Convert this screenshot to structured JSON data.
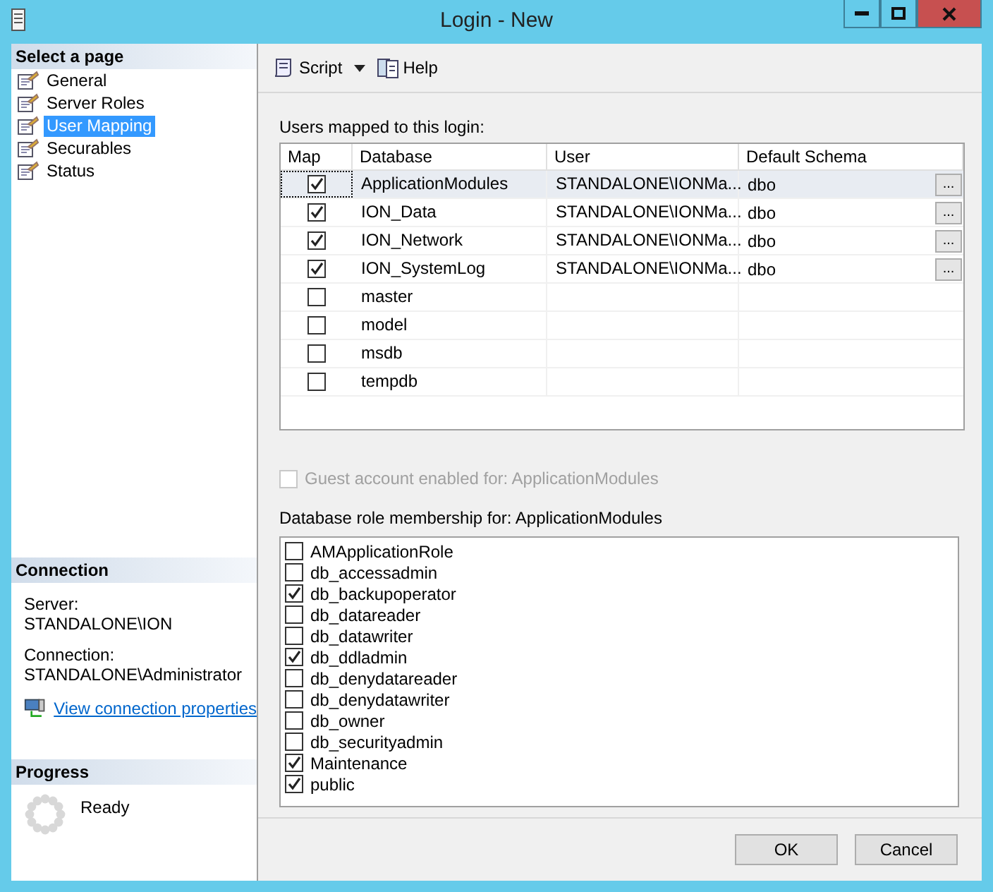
{
  "window": {
    "title": "Login - New"
  },
  "sidebar": {
    "header": "Select a page",
    "items": [
      {
        "label": "General",
        "selected": false
      },
      {
        "label": "Server Roles",
        "selected": false
      },
      {
        "label": "User Mapping",
        "selected": true
      },
      {
        "label": "Securables",
        "selected": false
      },
      {
        "label": "Status",
        "selected": false
      }
    ]
  },
  "connection": {
    "header": "Connection",
    "server_label": "Server:",
    "server": "STANDALONE\\ION",
    "connection_label": "Connection:",
    "connection": "STANDALONE\\Administrator",
    "link": "View connection properties"
  },
  "progress": {
    "header": "Progress",
    "status": "Ready"
  },
  "toolbar": {
    "script": "Script",
    "help": "Help"
  },
  "mapping": {
    "label": "Users mapped to this login:",
    "columns": [
      "Map",
      "Database",
      "User",
      "Default Schema"
    ],
    "rows": [
      {
        "map": true,
        "database": "ApplicationModules",
        "user": "STANDALONE\\IONMa...",
        "schema": "dbo",
        "browse": "...",
        "selected": true
      },
      {
        "map": true,
        "database": "ION_Data",
        "user": "STANDALONE\\IONMa...",
        "schema": "dbo",
        "browse": "...",
        "selected": false
      },
      {
        "map": true,
        "database": "ION_Network",
        "user": "STANDALONE\\IONMa...",
        "schema": "dbo",
        "browse": "...",
        "selected": false
      },
      {
        "map": true,
        "database": "ION_SystemLog",
        "user": "STANDALONE\\IONMa...",
        "schema": "dbo",
        "browse": "...",
        "selected": false
      },
      {
        "map": false,
        "database": "master",
        "selected": false
      },
      {
        "map": false,
        "database": "model",
        "selected": false
      },
      {
        "map": false,
        "database": "msdb",
        "selected": false
      },
      {
        "map": false,
        "database": "tempdb",
        "selected": false
      }
    ]
  },
  "guest": {
    "label": "Guest account enabled for: ApplicationModules",
    "checked": false,
    "disabled": true
  },
  "roles": {
    "label": "Database role membership for: ApplicationModules",
    "items": [
      {
        "label": "AMApplicationRole",
        "checked": false
      },
      {
        "label": "db_accessadmin",
        "checked": false
      },
      {
        "label": "db_backupoperator",
        "checked": true
      },
      {
        "label": "db_datareader",
        "checked": false
      },
      {
        "label": "db_datawriter",
        "checked": false
      },
      {
        "label": "db_ddladmin",
        "checked": true
      },
      {
        "label": "db_denydatareader",
        "checked": false
      },
      {
        "label": "db_denydatawriter",
        "checked": false
      },
      {
        "label": "db_owner",
        "checked": false
      },
      {
        "label": "db_securityadmin",
        "checked": false
      },
      {
        "label": "Maintenance",
        "checked": true
      },
      {
        "label": "public",
        "checked": true
      }
    ]
  },
  "buttons": [
    "OK",
    "Cancel"
  ]
}
